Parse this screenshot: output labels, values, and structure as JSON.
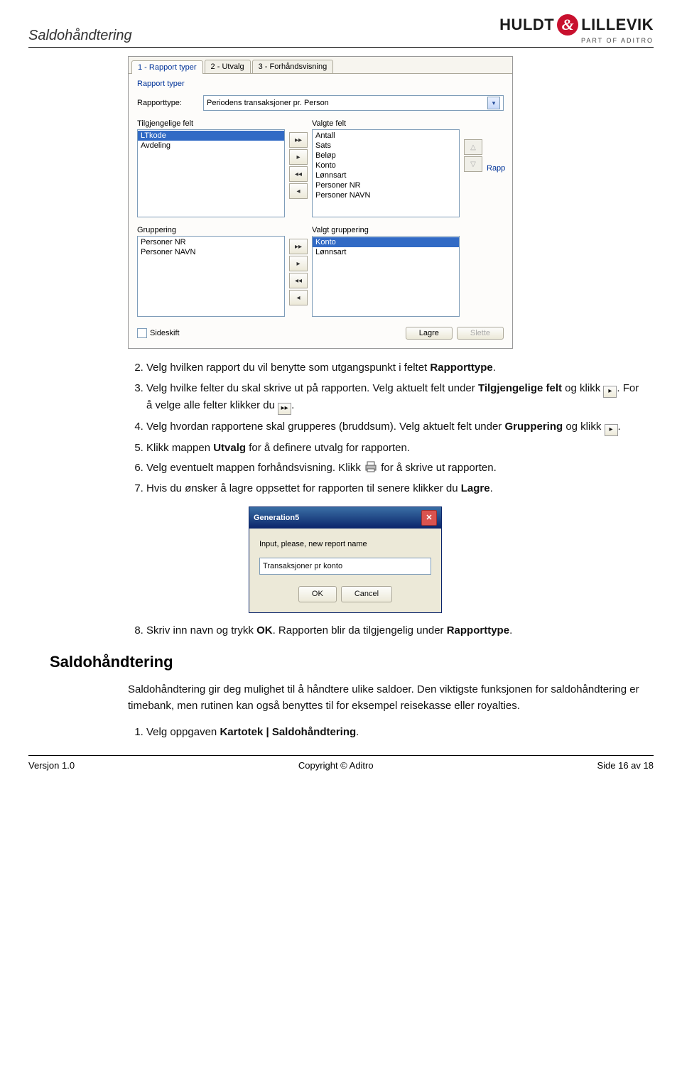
{
  "header": {
    "title": "Saldohåndtering"
  },
  "brand": {
    "left": "HULDT",
    "right": "LILLEVIK",
    "sub": "PART OF ADITRO"
  },
  "window": {
    "tabs": [
      "1 - Rapport typer",
      "2 - Utvalg",
      "3 - Forhåndsvisning"
    ],
    "section": "Rapport typer",
    "rapporttype_label": "Rapporttype:",
    "rapporttype_value": "Periodens transaksjoner pr. Person",
    "available_label": "Tilgjengelige felt",
    "selected_label": "Valgte felt",
    "available_items": [
      "LTkode",
      "Avdeling"
    ],
    "selected_items": [
      "Antall",
      "Sats",
      "Beløp",
      "Konto",
      "Lønnsart",
      "Personer NR",
      "Personer NAVN"
    ],
    "rap_hint": "Rapp",
    "grouping_label": "Gruppering",
    "grouping_selected_label": "Valgt gruppering",
    "grouping_available": [
      "Personer NR",
      "Personer NAVN"
    ],
    "grouping_selected": [
      "Konto",
      "Lønnsart"
    ],
    "sideskift": "Sideskift",
    "save_btn": "Lagre",
    "delete_btn": "Slette"
  },
  "steps": {
    "s2a": "Velg hvilken rapport du vil benytte som utgangspunkt i feltet ",
    "s2b": "Rapporttype",
    "s3a": "Velg hvilke felter du skal skrive ut på rapporten. Velg aktuelt felt under ",
    "s3b": "Tilgjengelige felt",
    "s3c": " og klikk ",
    "s3d": ". For å velge alle felter klikker du ",
    "s4a": "Velg hvordan rapportene skal grupperes (bruddsum). Velg aktuelt felt under ",
    "s4b": "Gruppering",
    "s4c": " og klikk ",
    "s5a": "Klikk mappen ",
    "s5b": "Utvalg",
    "s5c": " for å definere utvalg for rapporten.",
    "s6a": "Velg eventuelt mappen forhåndsvisning. Klikk ",
    "s6b": " for å skrive ut rapporten.",
    "s7a": "Hvis du ønsker å lagre oppsettet for rapporten til senere klikker du ",
    "s7b": "Lagre",
    "s8a": "Skriv inn navn og trykk ",
    "s8b": "OK",
    "s8c": ". Rapporten blir da tilgjengelig under ",
    "s8d": "Rapporttype"
  },
  "dialog": {
    "title": "Generation5",
    "label": "Input, please, new report name",
    "value": "Transaksjoner pr konto",
    "ok": "OK",
    "cancel": "Cancel"
  },
  "subheading": "Saldohåndtering",
  "para": "Saldohåndtering gir deg mulighet til å håndtere ulike saldoer. Den viktigste funksjonen for saldohåndtering er timebank, men rutinen kan også benyttes til for eksempel reisekasse eller royalties.",
  "step_menu_a": "Velg oppgaven ",
  "step_menu_b": "Kartotek | Saldohåndtering",
  "footer": {
    "version": "Versjon 1.0",
    "copyright": "Copyright © Aditro",
    "page": "Side 16 av 18"
  }
}
